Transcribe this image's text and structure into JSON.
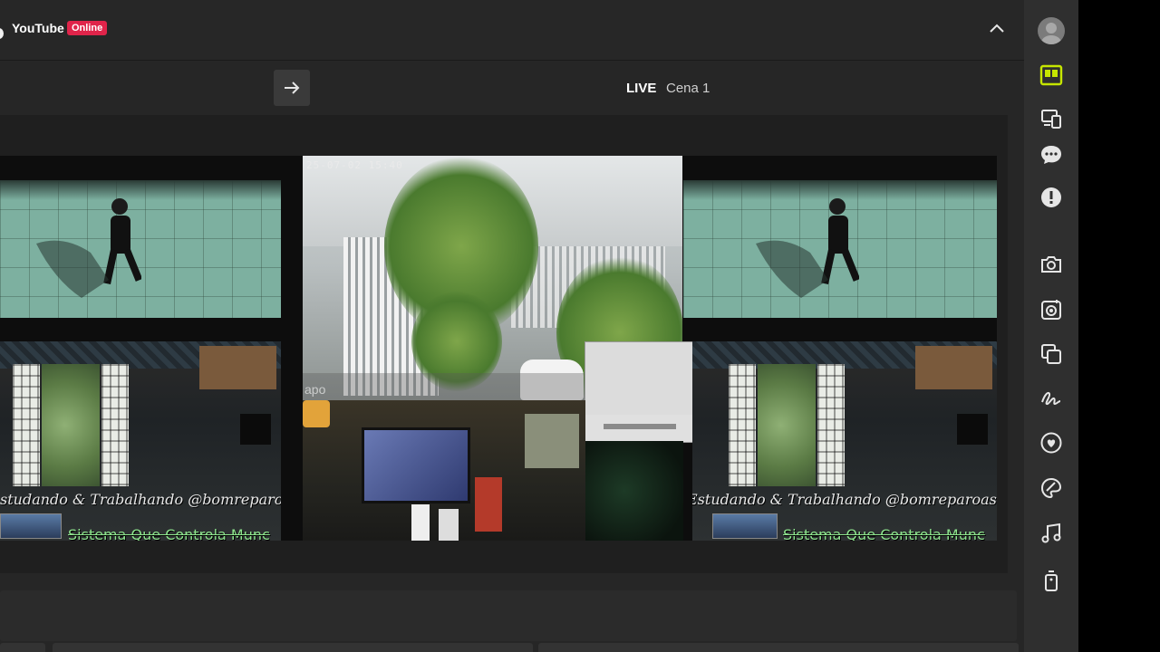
{
  "header": {
    "app_title": "YouTube",
    "status_badge": "Online"
  },
  "preview": {
    "live_label": "LIVE",
    "scene_name": "Cena 1"
  },
  "canvas": {
    "camera_timestamp": "25-07-02 15:40",
    "camera_logo": "apo",
    "overlay_left_caption": "studando & Trabalhando @bomreparoassistenc",
    "overlay_left_ticker": "Sistema Que Controla Munc",
    "overlay_right_caption": "Estudando & Trabalhando @bomreparoassistenc",
    "overlay_right_ticker": "Sistema Que Controla Munc"
  },
  "sidebar": {
    "items": [
      {
        "icon": "avatar-icon"
      },
      {
        "icon": "layout-icon",
        "active": true
      },
      {
        "icon": "devices-icon"
      },
      {
        "icon": "chat-icon"
      },
      {
        "icon": "alert-icon"
      },
      {
        "icon": "camera-icon"
      },
      {
        "icon": "capture-icon"
      },
      {
        "icon": "layers-icon"
      },
      {
        "icon": "signature-icon"
      },
      {
        "icon": "heart-icon"
      },
      {
        "icon": "palette-icon"
      },
      {
        "icon": "music-icon"
      },
      {
        "icon": "remote-icon"
      }
    ]
  },
  "colors": {
    "accent": "#c6e600",
    "badge": "#e0244a",
    "sidebar_bg": "#2f2f2f",
    "main_bg": "#262626"
  }
}
